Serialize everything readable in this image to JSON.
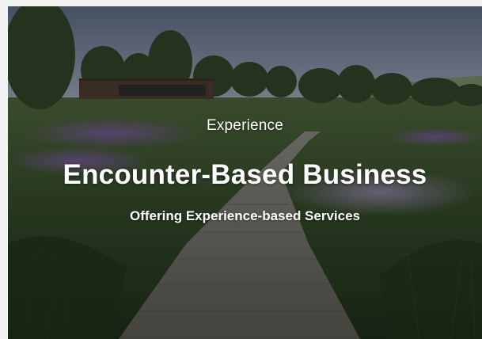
{
  "hero": {
    "eyebrow": "Experience",
    "title": "Encounter-Based Business",
    "subtitle": "Offering Experience-based Services"
  },
  "colors": {
    "sky": "#7a8aa6",
    "path": "#6e6e6a",
    "grass": "#3f5a2e",
    "flowers": "#6a4a7e",
    "text": "#ffffff"
  }
}
